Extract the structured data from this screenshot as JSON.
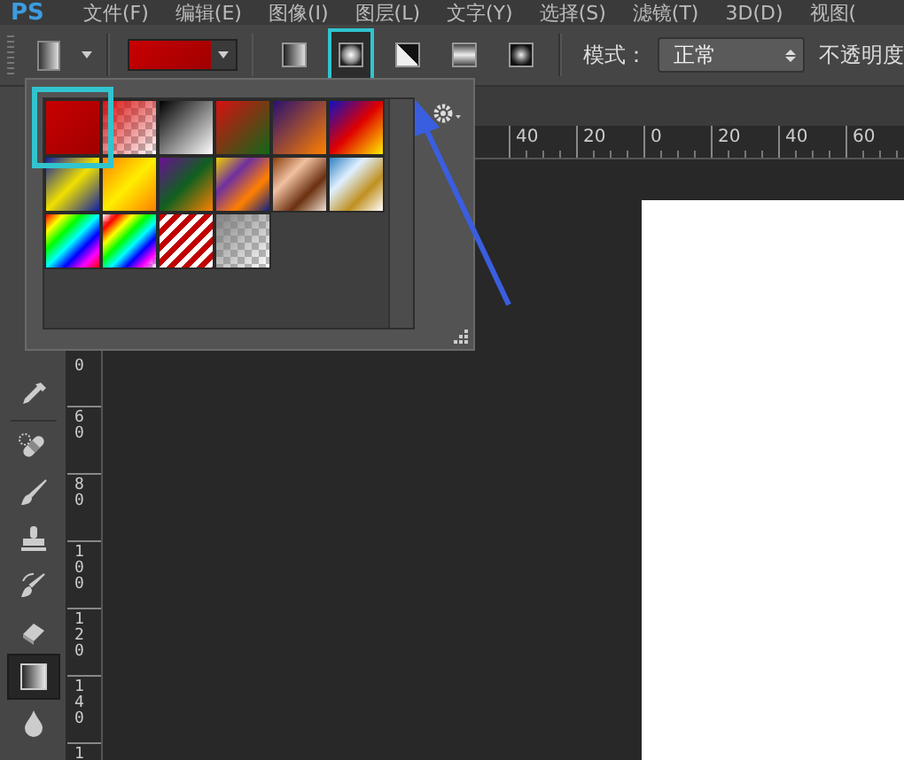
{
  "menu": [
    {
      "label": "PS",
      "kind": "logo"
    },
    {
      "label": "文件(F)",
      "kind": "menu"
    },
    {
      "label": "编辑(E)",
      "kind": "menu"
    },
    {
      "label": "图像(I)",
      "kind": "menu"
    },
    {
      "label": "图层(L)",
      "kind": "menu"
    },
    {
      "label": "文字(Y)",
      "kind": "menu"
    },
    {
      "label": "选择(S)",
      "kind": "menu"
    },
    {
      "label": "滤镜(T)",
      "kind": "menu"
    },
    {
      "label": "3D(D)",
      "kind": "menu"
    },
    {
      "label": "视图(",
      "kind": "menu"
    }
  ],
  "options": {
    "gradient_types": [
      {
        "kind": "linear",
        "selected": false
      },
      {
        "kind": "radial",
        "selected": true
      },
      {
        "kind": "angle",
        "selected": false
      },
      {
        "kind": "reflected",
        "selected": false
      },
      {
        "kind": "diamond",
        "selected": false
      }
    ],
    "mode_label": "模式：",
    "mode_value": "正常",
    "opacity_label": "不透明度"
  },
  "tools": [
    {
      "kind": "eyedropper",
      "selected": false
    },
    {
      "kind": "bandage",
      "selected": false
    },
    {
      "kind": "brush",
      "selected": false
    },
    {
      "kind": "stamp",
      "selected": false
    },
    {
      "kind": "history-brush",
      "selected": false
    },
    {
      "kind": "eraser",
      "selected": false
    },
    {
      "kind": "gradient",
      "selected": true
    },
    {
      "kind": "drop",
      "selected": false
    }
  ],
  "h_ruler": [
    "40",
    "20",
    "0",
    "20",
    "40",
    "60"
  ],
  "v_ruler": [
    "0",
    "60",
    "80",
    "100",
    "120",
    "140",
    "1"
  ],
  "gradient_picker": {
    "swatches": [
      {
        "selected": true
      },
      {
        "selected": false
      },
      {
        "selected": false
      },
      {
        "selected": false
      },
      {
        "selected": false
      },
      {
        "selected": false
      },
      {
        "selected": false
      },
      {
        "selected": false
      },
      {
        "selected": false
      },
      {
        "selected": false
      },
      {
        "selected": false
      },
      {
        "selected": false
      },
      {
        "selected": false
      },
      {
        "selected": false
      },
      {
        "selected": false
      },
      {
        "selected": false
      }
    ]
  }
}
